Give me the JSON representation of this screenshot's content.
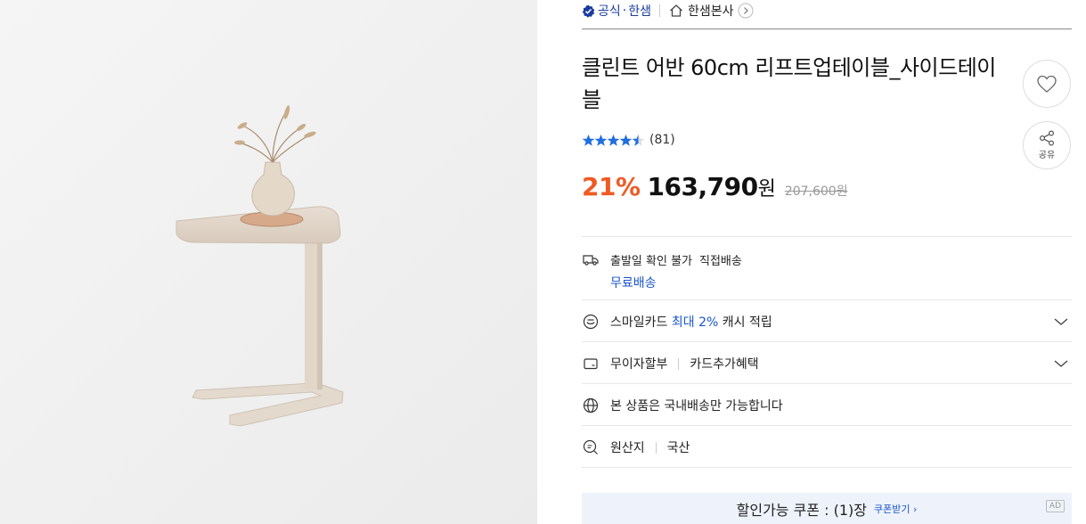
{
  "store": {
    "official_label": "공식",
    "brand_label": "한샘",
    "brand_home_label": "한샘본사"
  },
  "product": {
    "title": "클린트 어반 60cm 리프트업테이블_사이드테이블",
    "rating_stars": 4.5,
    "review_count": "(81)",
    "discount": "21%",
    "price": "163,790",
    "currency": "원",
    "original_price": "207,600원"
  },
  "actions": {
    "share_label": "공유"
  },
  "shipping": {
    "dispatch_label": "출발일 확인 불가",
    "method_label": "직접배송",
    "fee_label": "무료배송"
  },
  "smilecard": {
    "prefix": "스마일카드",
    "highlight": "최대 2%",
    "suffix": "캐시 적립"
  },
  "installment": {
    "label": "무이자할부",
    "extra": "카드추가혜택"
  },
  "domestic": {
    "label": "본 상품은 국내배송만 가능합니다"
  },
  "origin": {
    "label": "원산지",
    "value": "국산"
  },
  "coupon": {
    "label": "할인가능 쿠폰 : (1)장",
    "get_label": "쿠폰받기 ›",
    "ad_label": "AD"
  },
  "colors": {
    "discount": "#f05a23",
    "link_blue": "#1a56c9",
    "official_blue": "#1a3c9e",
    "star": "#1f6fe0"
  }
}
